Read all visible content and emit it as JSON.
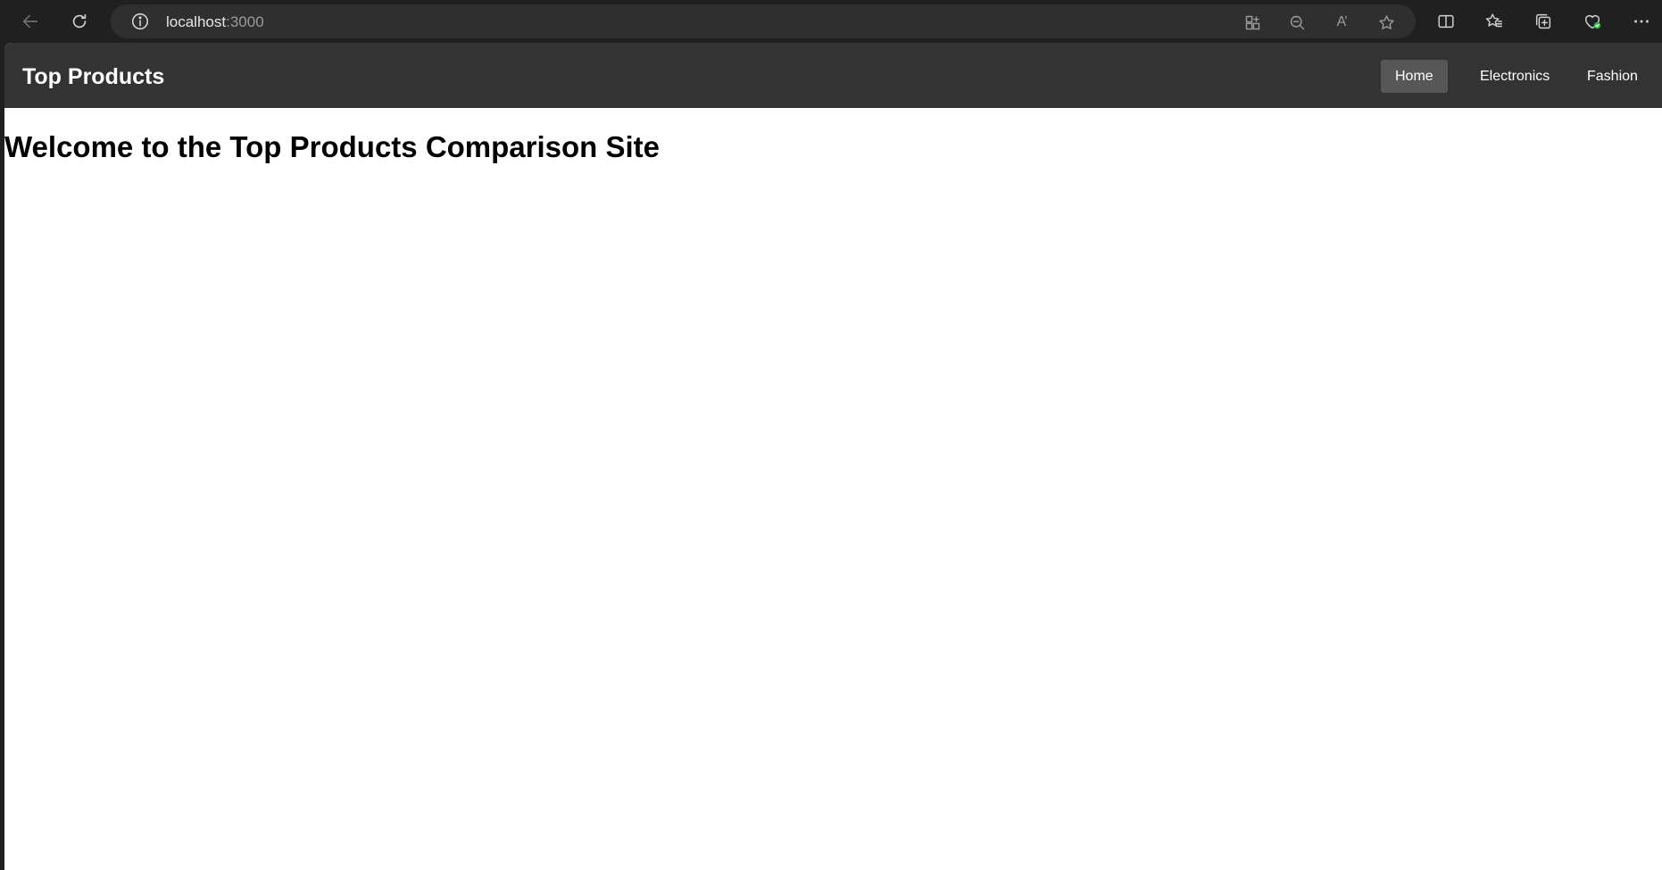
{
  "browser": {
    "url_host": "localhost",
    "url_port": ":3000",
    "read_aloud_label": "A’"
  },
  "site": {
    "brand": "Top Products",
    "nav": [
      {
        "label": "Home",
        "active": true
      },
      {
        "label": "Electronics",
        "active": false
      },
      {
        "label": "Fashion",
        "active": false
      }
    ]
  },
  "main": {
    "heading": "Welcome to the Top Products Comparison Site"
  },
  "colors": {
    "navbar_bg": "#333333",
    "nav_active_bg": "#575757",
    "chrome_bg": "#202020",
    "profile_badge": "#2dbd4e"
  }
}
